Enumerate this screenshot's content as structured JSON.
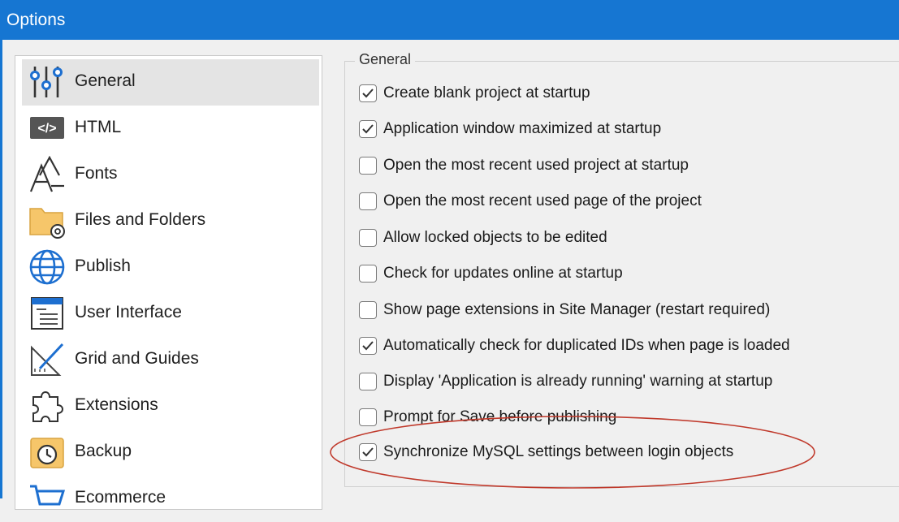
{
  "window": {
    "title": "Options"
  },
  "sidebar": {
    "items": [
      {
        "label": "General",
        "icon": "sliders-icon",
        "selected": true
      },
      {
        "label": "HTML",
        "icon": "code-icon"
      },
      {
        "label": "Fonts",
        "icon": "fonts-icon"
      },
      {
        "label": "Files and Folders",
        "icon": "folder-gear-icon"
      },
      {
        "label": "Publish",
        "icon": "globe-icon"
      },
      {
        "label": "User Interface",
        "icon": "window-icon"
      },
      {
        "label": "Grid and Guides",
        "icon": "ruler-triangle-icon"
      },
      {
        "label": "Extensions",
        "icon": "puzzle-icon"
      },
      {
        "label": "Backup",
        "icon": "backup-clock-icon"
      },
      {
        "label": "Ecommerce",
        "icon": "cart-icon"
      }
    ]
  },
  "general": {
    "title": "General",
    "options": [
      {
        "label": "Create blank project at startup",
        "checked": true
      },
      {
        "label": "Application window maximized at startup",
        "checked": true
      },
      {
        "label": "Open the most recent used project at startup",
        "checked": false
      },
      {
        "label": "Open the most recent used page of the project",
        "checked": false
      },
      {
        "label": "Allow locked objects to be edited",
        "checked": false
      },
      {
        "label": "Check for updates online at startup",
        "checked": false
      },
      {
        "label": "Show page extensions in Site Manager (restart required)",
        "checked": false
      },
      {
        "label": "Automatically check for duplicated IDs when page is loaded",
        "checked": true
      },
      {
        "label": "Display 'Application is already running' warning at startup",
        "checked": false
      },
      {
        "label": "Prompt for Save before publishing",
        "checked": false
      },
      {
        "label": "Synchronize MySQL settings between login objects",
        "checked": true
      }
    ]
  },
  "colors": {
    "titlebar": "#1676d2",
    "annotation": "#c0392b",
    "icon_blue": "#1d6fd0"
  }
}
